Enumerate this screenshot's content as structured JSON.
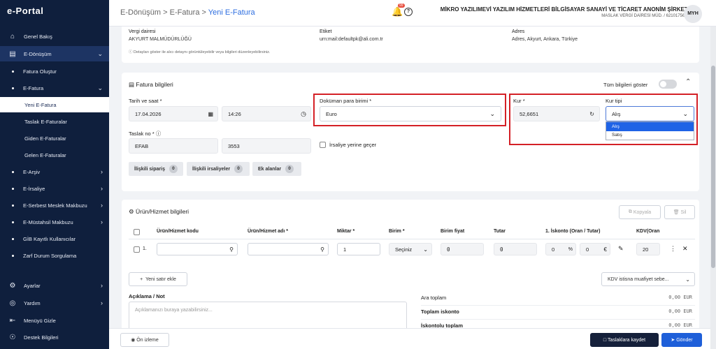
{
  "app": {
    "logo": "e-Portal"
  },
  "sidebar": {
    "items": [
      {
        "label": "Genel Bakış"
      },
      {
        "label": "E-Dönüşüm"
      },
      {
        "label": "Fatura Oluştur"
      },
      {
        "label": "E-Fatura"
      },
      {
        "label": "Yeni E-Fatura"
      },
      {
        "label": "Taslak E-Faturalar"
      },
      {
        "label": "Giden E-Faturalar"
      },
      {
        "label": "Gelen E-Faturalar"
      },
      {
        "label": "E-Arşiv"
      },
      {
        "label": "E-İrsaliye"
      },
      {
        "label": "E-Serbest Meslek Makbuzu"
      },
      {
        "label": "E-Müstahsil Makbuzu"
      },
      {
        "label": "GİB Kayıtlı Kullanıcılar"
      },
      {
        "label": "Zarf Durum Sorgulama"
      },
      {
        "label": "Ayarlar"
      },
      {
        "label": "Yardım"
      },
      {
        "label": "Menüyü Gizle"
      },
      {
        "label": "Destek Bilgileri"
      }
    ]
  },
  "header": {
    "breadcrumb": {
      "part1": "E-Dönüşüm",
      "sep": ">",
      "part2": "E-Fatura",
      "current": "Yeni E-Fatura"
    },
    "notif_count": "99",
    "company_name": "MİKRO YAZILIMEVİ YAZILIM HİZMETLERİ BİLGİSAYAR SANAYİ VE TİCARET ANONİM ŞİRKETİ",
    "company_sub": "MASLAK VERGİ DAİRESİ MÜD. / 6210175621",
    "avatar": "MYH"
  },
  "receiver": {
    "tax_office_label": "Vergi dairesi",
    "tax_office": "AKYURT MALMÜDÜRLÜĞÜ",
    "tag_label": "Etiket",
    "tag": "urn:mail:defaultpk@ali.com.tr",
    "address_label": "Adres",
    "address": "Adres, Akyurt, Ankara, Türkiye",
    "hint": "Detayları göster ile alıcı detaynı görüntüleyebilir veya bilgileri düzenleyebilirsiniz."
  },
  "invoice": {
    "section_title": "Fatura bilgileri",
    "show_all_label": "Tüm bilgileri göster",
    "date_label": "Tarih ve saat *",
    "date": "17.04.2026",
    "time": "14:26",
    "currency_label": "Doküman para birimi *",
    "currency": "Euro",
    "rate_label": "Kur *",
    "rate": "52,6651",
    "rate_type_label": "Kur tipi",
    "rate_type": "Alış",
    "rate_type_options": [
      "Alış",
      "Satış"
    ],
    "serial_label": "Taslak no *",
    "serial_prefix": "EFAB",
    "serial_no": "3553",
    "waybill_label": "İrsaliye yerine geçer",
    "tabs": [
      {
        "label": "İlişkili sipariş",
        "count": "0"
      },
      {
        "label": "İlişkili irsaliyeler",
        "count": "0"
      },
      {
        "label": "Ek alanlar",
        "count": "0"
      }
    ]
  },
  "products": {
    "section_title": "Ürün/Hizmet bilgileri",
    "copy_label": "Kopyala",
    "delete_label": "Sil",
    "columns": [
      "Ürün/Hizmet kodu",
      "Ürün/Hizmet adı *",
      "Miktar *",
      "Birim *",
      "Birim fiyat",
      "Tutar",
      "1. İskonto (Oran / Tutar)",
      "KDV(Oran"
    ],
    "row": {
      "no": "1.",
      "qty": "1",
      "unit": "Seçiniz",
      "price": "0",
      "amount": "0",
      "disc_rate": "0",
      "disc_amount": "0",
      "vat": "20"
    },
    "add_row_label": "Yeni satır ekle",
    "vat_exempt_label": "KDV istisna muafiyet sebe..."
  },
  "notes": {
    "label": "Açıklama / Not",
    "placeholder": "Açıklamanızı buraya yazabilirsiniz..."
  },
  "totals": [
    {
      "label": "Ara toplam",
      "value": "0,00 EUR"
    },
    {
      "label": "Toplam iskonto",
      "value": "0,00 EUR"
    },
    {
      "label": "İskontolu toplam",
      "value": "0,00 EUR"
    }
  ],
  "footer": {
    "preview_label": "Ön izleme",
    "save_draft_label": "Taslaklara kaydet",
    "send_label": "Gönder"
  },
  "colors": {
    "sidebar": "#0f1f3d",
    "primary": "#1e5fd9",
    "highlight": "#d42026",
    "dropdown_selected": "#1f63e6"
  }
}
